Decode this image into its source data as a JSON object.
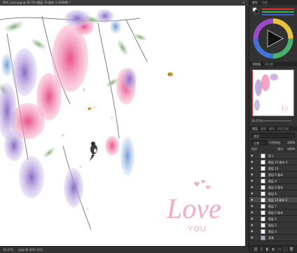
{
  "document": {
    "tab_title": "DSC_xxxx.jpg @ 16.7% (图层 10 副本 3, RGB/8) *",
    "close_glyph": "×"
  },
  "status": {
    "zoom": "16.67%",
    "doc_size": "文档:48.5M/1.92G"
  },
  "canvas": {
    "love_text": "Love",
    "you_text": "YOU",
    "accent": "#f2a8c6"
  },
  "right_panel": {
    "color_tab": "颜色",
    "swatches_tab": "色板",
    "navigator_tab": "导航器",
    "histogram_tab": "直方图",
    "navigator_zoom": "16.67%",
    "layers_tab": "图层",
    "channels_tab": "通道",
    "paths_tab": "路径",
    "props_tab": "历史记录",
    "filter_label": "类型",
    "blend_mode": "正常",
    "opacity_label": "不透明度:",
    "opacity_value": "100%",
    "lock_label": "锁定:",
    "fill_label": "填充:",
    "fill_value": "100%"
  },
  "layers": [
    {
      "name": "组 1",
      "thumb": "light"
    },
    {
      "name": "图层 10 副本 4",
      "thumb": "light"
    },
    {
      "name": "图层 10",
      "thumb": "light"
    },
    {
      "name": "图层 9 副本",
      "thumb": "light"
    },
    {
      "name": "图层 9",
      "thumb": "light"
    },
    {
      "name": "图层 8 副本",
      "thumb": "light"
    },
    {
      "name": "图层 8",
      "thumb": "light"
    },
    {
      "name": "图层 10 副本 3",
      "thumb": "light"
    },
    {
      "name": "图层 7",
      "thumb": "light"
    },
    {
      "name": "图层 6 副本",
      "thumb": "light"
    },
    {
      "name": "图层 6",
      "thumb": "light"
    },
    {
      "name": "图层 5",
      "thumb": "light"
    },
    {
      "name": "图层 4",
      "thumb": "light"
    },
    {
      "name": "背景",
      "thumb": "dark"
    }
  ],
  "layer_footer_icons": [
    "link-icon",
    "fx-icon",
    "mask-icon",
    "adjust-icon",
    "folder-icon",
    "new-layer-icon",
    "trash-icon"
  ]
}
